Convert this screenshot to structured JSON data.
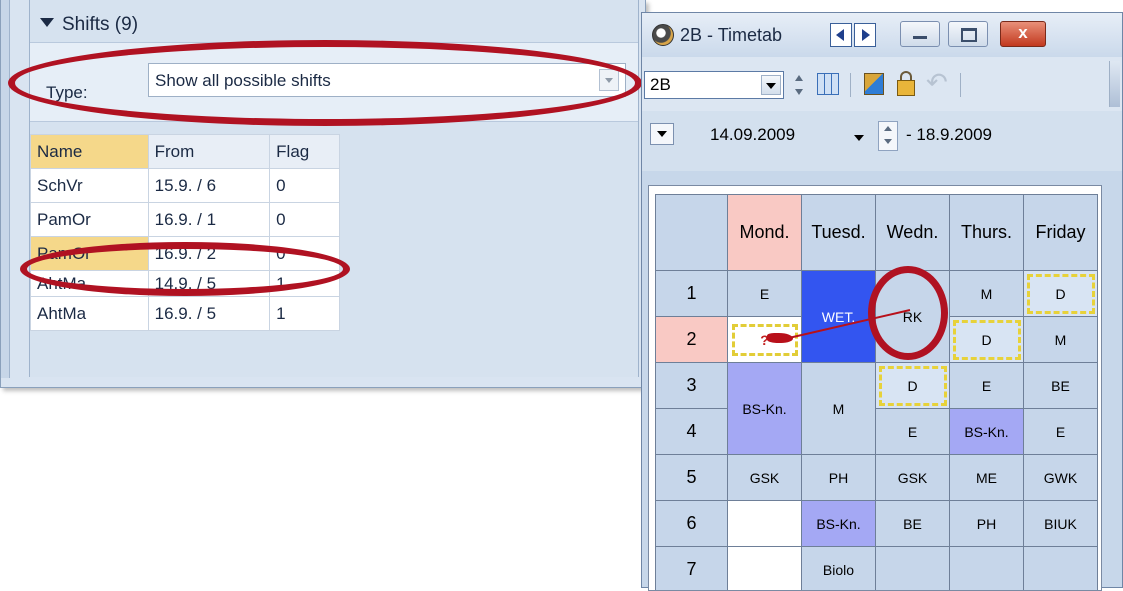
{
  "shifts_panel": {
    "header": "Shifts (9)",
    "type_label": "Type:",
    "type_value": "Show all possible shifts",
    "columns": [
      "Name",
      "From",
      "Flag"
    ],
    "rows": [
      {
        "name": "SchVr",
        "from": "15.9. / 6",
        "flag": "0"
      },
      {
        "name": "PamOr",
        "from": "16.9. / 1",
        "flag": "0"
      },
      {
        "name": "PamOr",
        "from": "16.9. / 2",
        "flag": "0"
      },
      {
        "name": "AhtMa",
        "from": "14.9. / 5",
        "flag": "1"
      },
      {
        "name": "AhtMa",
        "from": "16.9. / 5",
        "flag": "1"
      }
    ]
  },
  "window": {
    "title": "2B -  Timetab",
    "class_value": "2B",
    "date_from": "14.09.2009",
    "date_to": "- 18.9.2009",
    "close_glyph": "x"
  },
  "timetable": {
    "days": [
      "Mond.",
      "Tuesd.",
      "Wedn.",
      "Thurs.",
      "Friday"
    ],
    "periods": [
      "1",
      "2",
      "3",
      "4",
      "5",
      "6",
      "7"
    ],
    "cells": {
      "p1": [
        "E",
        "WET.",
        "RK",
        "M",
        "D"
      ],
      "p2": [
        "?",
        "D",
        "M"
      ],
      "p3": [
        "BS-Kn.",
        "M",
        "D",
        "E",
        "BE"
      ],
      "p4": [
        "E",
        "BS-Kn.",
        "E"
      ],
      "p5": [
        "GSK",
        "PH",
        "GSK",
        "ME",
        "GWK"
      ],
      "p6": [
        "",
        "BS-Kn.",
        "BE",
        "PH",
        "BIUK"
      ],
      "p7": [
        "",
        "Biolo",
        "",
        "",
        ""
      ]
    }
  },
  "colors": {
    "highlight_ring": "#b01222",
    "selected_row": "#f5d88a",
    "wet_block": "#3355f0",
    "bs_block": "#a4a8f4",
    "monday_header": "#f9c9c4"
  }
}
